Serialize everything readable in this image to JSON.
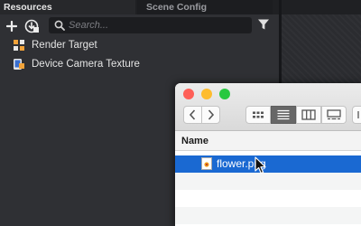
{
  "tabs": {
    "resources": "Resources",
    "scene_config": "Scene Config"
  },
  "toolbar": {
    "add_icon": "plus-icon",
    "import_icon": "import-icon"
  },
  "search": {
    "placeholder": "Search..."
  },
  "resources": [
    {
      "label": "Render Target",
      "icon": "render-target-icon"
    },
    {
      "label": "Device Camera Texture",
      "icon": "device-camera-texture-icon"
    }
  ],
  "finder": {
    "column_header": "Name",
    "file": {
      "name": "flower.png",
      "selected": true
    }
  },
  "colors": {
    "selection": "#1a69d2",
    "close": "#fe5f57",
    "minimize": "#febc2e",
    "zoom": "#28c840"
  }
}
